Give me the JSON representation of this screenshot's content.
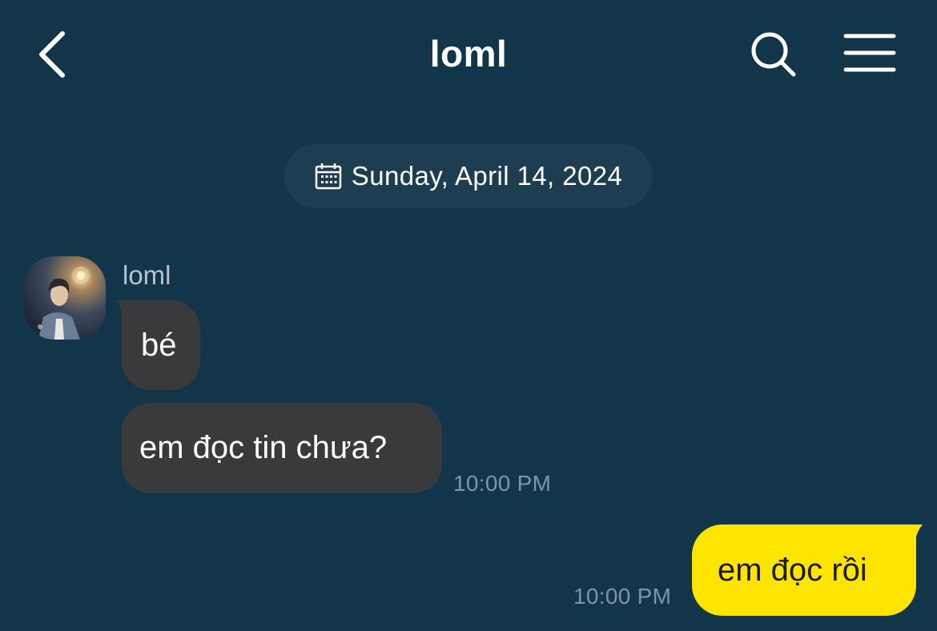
{
  "header": {
    "title": "loml",
    "back_icon": "chevron-left-icon",
    "search_icon": "search-icon",
    "menu_icon": "hamburger-menu-icon"
  },
  "date_divider": {
    "icon": "calendar-icon",
    "label": "Sunday, April 14, 2024"
  },
  "messages": [
    {
      "sender": "loml",
      "text": "bé",
      "direction": "incoming"
    },
    {
      "sender": "loml",
      "text": "em đọc tin chưa?",
      "time": "10:00 PM",
      "direction": "incoming"
    },
    {
      "sender": "me",
      "text": "em đọc rồi",
      "time": "10:00 PM",
      "direction": "outgoing"
    }
  ],
  "colors": {
    "background": "#12354a",
    "incoming_bubble": "#3a3a3c",
    "outgoing_bubble": "#fee500",
    "date_pill": "#1d3d50",
    "timestamp": "#7f95a3"
  }
}
